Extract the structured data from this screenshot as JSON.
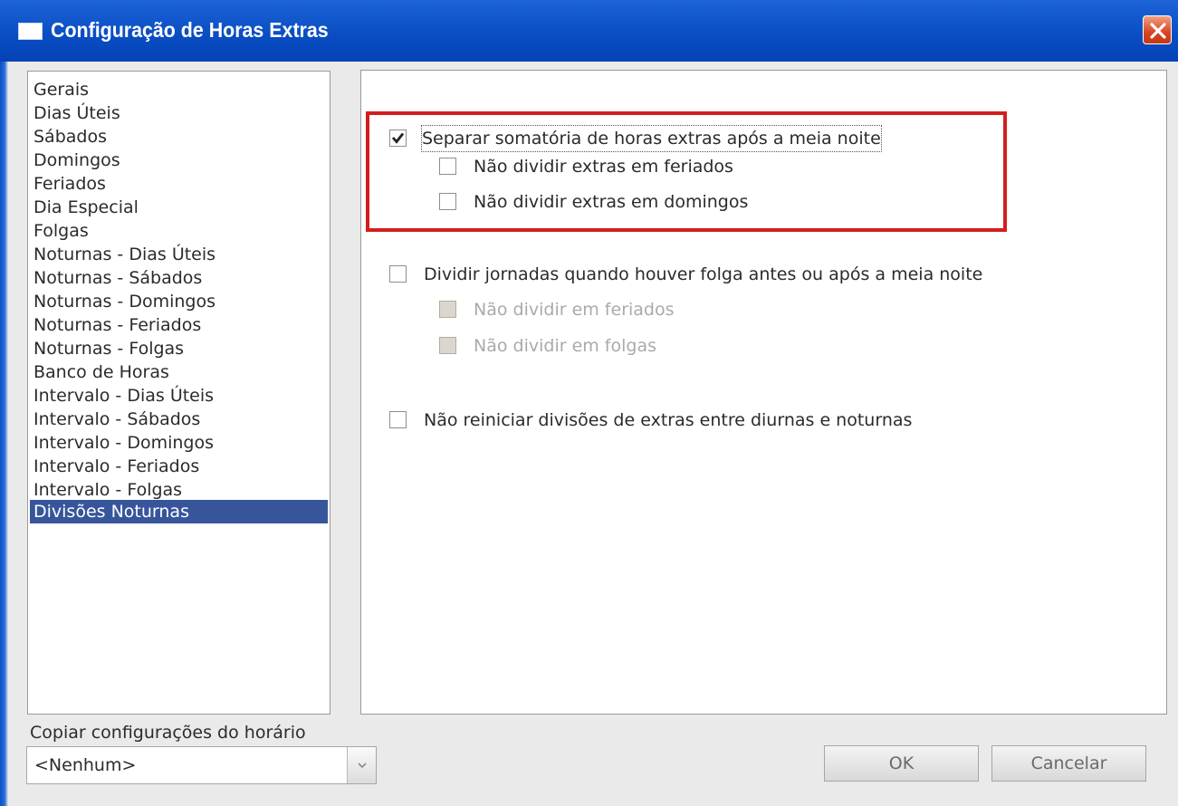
{
  "window": {
    "title": "Configuração de Horas Extras"
  },
  "sidebar": {
    "items": [
      {
        "label": "Gerais",
        "selected": false
      },
      {
        "label": "Dias Úteis",
        "selected": false
      },
      {
        "label": "Sábados",
        "selected": false
      },
      {
        "label": "Domingos",
        "selected": false
      },
      {
        "label": "Feriados",
        "selected": false
      },
      {
        "label": "Dia Especial",
        "selected": false
      },
      {
        "label": "Folgas",
        "selected": false
      },
      {
        "label": "Noturnas - Dias Úteis",
        "selected": false
      },
      {
        "label": "Noturnas - Sábados",
        "selected": false
      },
      {
        "label": "Noturnas - Domingos",
        "selected": false
      },
      {
        "label": "Noturnas - Feriados",
        "selected": false
      },
      {
        "label": "Noturnas - Folgas",
        "selected": false
      },
      {
        "label": "Banco de Horas",
        "selected": false
      },
      {
        "label": "Intervalo - Dias Úteis",
        "selected": false
      },
      {
        "label": "Intervalo - Sábados",
        "selected": false
      },
      {
        "label": "Intervalo - Domingos",
        "selected": false
      },
      {
        "label": "Intervalo - Feriados",
        "selected": false
      },
      {
        "label": "Intervalo - Folgas",
        "selected": false
      },
      {
        "label": "Divisões Noturnas",
        "selected": true
      }
    ]
  },
  "options": {
    "separar": {
      "label": "Separar somatória de horas extras após a meia noite",
      "checked": true,
      "enabled": true
    },
    "separar_feriados": {
      "label": "Não dividir extras em feriados",
      "checked": false,
      "enabled": true
    },
    "separar_domingos": {
      "label": "Não dividir extras em domingos",
      "checked": false,
      "enabled": true
    },
    "dividir": {
      "label": "Dividir jornadas quando houver folga antes ou após a meia noite",
      "checked": false,
      "enabled": true
    },
    "dividir_feriados": {
      "label": "Não dividir em feriados",
      "checked": false,
      "enabled": false
    },
    "dividir_folgas": {
      "label": "Não dividir em folgas",
      "checked": false,
      "enabled": false
    },
    "nao_reiniciar": {
      "label": "Não reiniciar divisões de extras entre diurnas e noturnas",
      "checked": false,
      "enabled": true
    }
  },
  "copy": {
    "label": "Copiar configurações do horário",
    "selected_value": "<Nenhum>"
  },
  "buttons": {
    "ok": "OK",
    "cancel": "Cancelar"
  },
  "colors": {
    "titlebar": "#0a4ec4",
    "selection": "#37559b",
    "highlight": "#d41e1e",
    "close": "#d8451e"
  }
}
